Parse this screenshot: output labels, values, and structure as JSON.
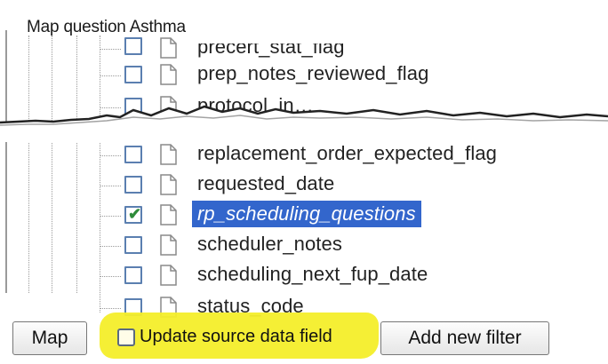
{
  "panel": {
    "title": "Map question Asthma"
  },
  "tree": {
    "items": [
      {
        "label": "precert_stat_flag",
        "checked": false,
        "selected": false
      },
      {
        "label": "prep_notes_reviewed_flag",
        "checked": false,
        "selected": false
      },
      {
        "label": "protocol_in…",
        "checked": false,
        "selected": false
      },
      {
        "label": "replacement_order_expected_flag",
        "checked": false,
        "selected": false
      },
      {
        "label": "requested_date",
        "checked": false,
        "selected": false
      },
      {
        "label": "rp_scheduling_questions",
        "checked": true,
        "selected": true
      },
      {
        "label": "scheduler_notes",
        "checked": false,
        "selected": false
      },
      {
        "label": "scheduling_next_fup_date",
        "checked": false,
        "selected": false
      },
      {
        "label": "status_code",
        "checked": false,
        "selected": false
      }
    ]
  },
  "footer": {
    "map_label": "Map",
    "update_source_label": "Update source data field",
    "update_source_checked": false,
    "add_filter_label": "Add new filter"
  },
  "colors": {
    "selection": "#3366cc",
    "highlight": "#f4ee2a",
    "checkbox_border": "#5b7fb0",
    "checkmark": "#2e8b3a"
  }
}
